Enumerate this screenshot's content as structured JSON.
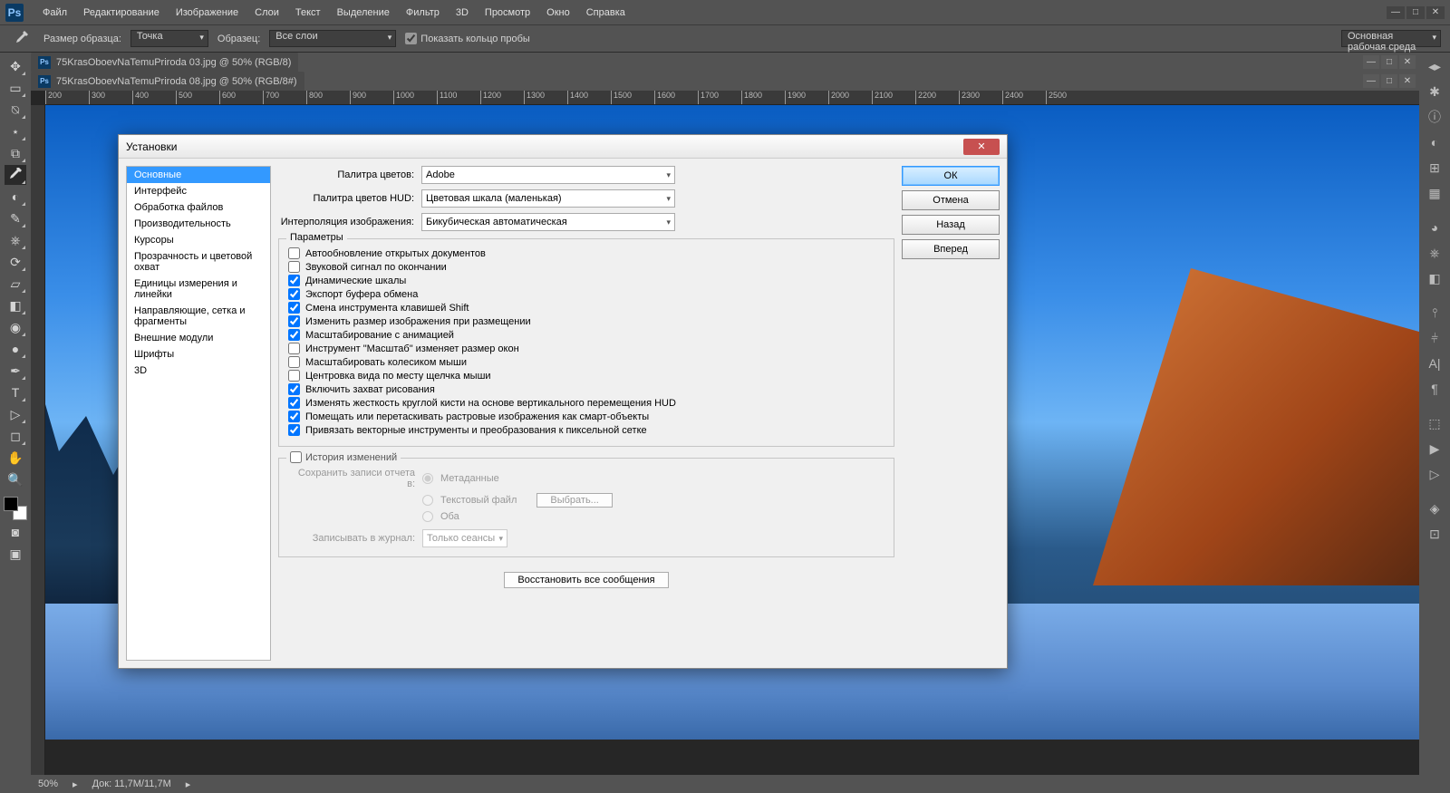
{
  "menubar": [
    "Файл",
    "Редактирование",
    "Изображение",
    "Слои",
    "Текст",
    "Выделение",
    "Фильтр",
    "3D",
    "Просмотр",
    "Окно",
    "Справка"
  ],
  "options": {
    "sample_size_label": "Размер образца:",
    "sample_size_value": "Точка",
    "sample_label": "Образец:",
    "sample_value": "Все слои",
    "show_ring": "Показать кольцо пробы",
    "workspace": "Основная рабочая среда"
  },
  "doc_tabs": [
    "75KrasOboevNaTemuPriroda 03.jpg @ 50% (RGB/8)",
    "75KrasOboevNaTemuPriroda 08.jpg @ 50% (RGB/8#)"
  ],
  "ruler_ticks": [
    200,
    300,
    400,
    500,
    600,
    700,
    800,
    900,
    1000,
    1100,
    1200,
    1300,
    1400,
    1500,
    1600,
    1700,
    1800,
    1900,
    2000,
    2100,
    2200,
    2300,
    2400,
    2500
  ],
  "status": {
    "zoom": "50%",
    "doc": "Док: 11,7M/11,7M"
  },
  "dialog": {
    "title": "Установки",
    "sidebar": [
      "Основные",
      "Интерфейс",
      "Обработка файлов",
      "Производительность",
      "Курсоры",
      "Прозрачность и цветовой охват",
      "Единицы измерения и линейки",
      "Направляющие, сетка и фрагменты",
      "Внешние модули",
      "Шрифты",
      "3D"
    ],
    "rows": {
      "color_picker_label": "Палитра цветов:",
      "color_picker_value": "Adobe",
      "hud_label": "Палитра цветов HUD:",
      "hud_value": "Цветовая шкала (маленькая)",
      "interp_label": "Интерполяция изображения:",
      "interp_value": "Бикубическая автоматическая"
    },
    "options_legend": "Параметры",
    "checkboxes": [
      {
        "checked": false,
        "label": "Автообновление открытых документов"
      },
      {
        "checked": false,
        "label": "Звуковой сигнал по окончании"
      },
      {
        "checked": true,
        "label": "Динамические шкалы"
      },
      {
        "checked": true,
        "label": "Экспорт буфера обмена"
      },
      {
        "checked": true,
        "label": "Смена инструмента клавишей Shift"
      },
      {
        "checked": true,
        "label": "Изменить размер изображения при размещении"
      },
      {
        "checked": true,
        "label": "Масштабирование с анимацией"
      },
      {
        "checked": false,
        "label": "Инструмент \"Масштаб\" изменяет размер окон"
      },
      {
        "checked": false,
        "label": "Масштабировать колесиком мыши"
      },
      {
        "checked": false,
        "label": "Центровка вида по месту щелчка мыши"
      },
      {
        "checked": true,
        "label": "Включить захват рисования"
      },
      {
        "checked": true,
        "label": "Изменять жесткость круглой кисти на основе вертикального перемещения HUD"
      },
      {
        "checked": true,
        "label": "Помещать или перетаскивать растровые изображения как смарт-объекты"
      },
      {
        "checked": true,
        "label": "Привязать векторные инструменты и преобразования к пиксельной сетке"
      }
    ],
    "history": {
      "legend": "История изменений",
      "save_label": "Сохранить записи отчета в:",
      "r1": "Метаданные",
      "r2": "Текстовый файл",
      "r3": "Оба",
      "choose": "Выбрать...",
      "log_label": "Записывать в журнал:",
      "log_value": "Только сеансы"
    },
    "reset": "Восстановить все сообщения",
    "buttons": {
      "ok": "ОК",
      "cancel": "Отмена",
      "prev": "Назад",
      "next": "Вперед"
    }
  }
}
